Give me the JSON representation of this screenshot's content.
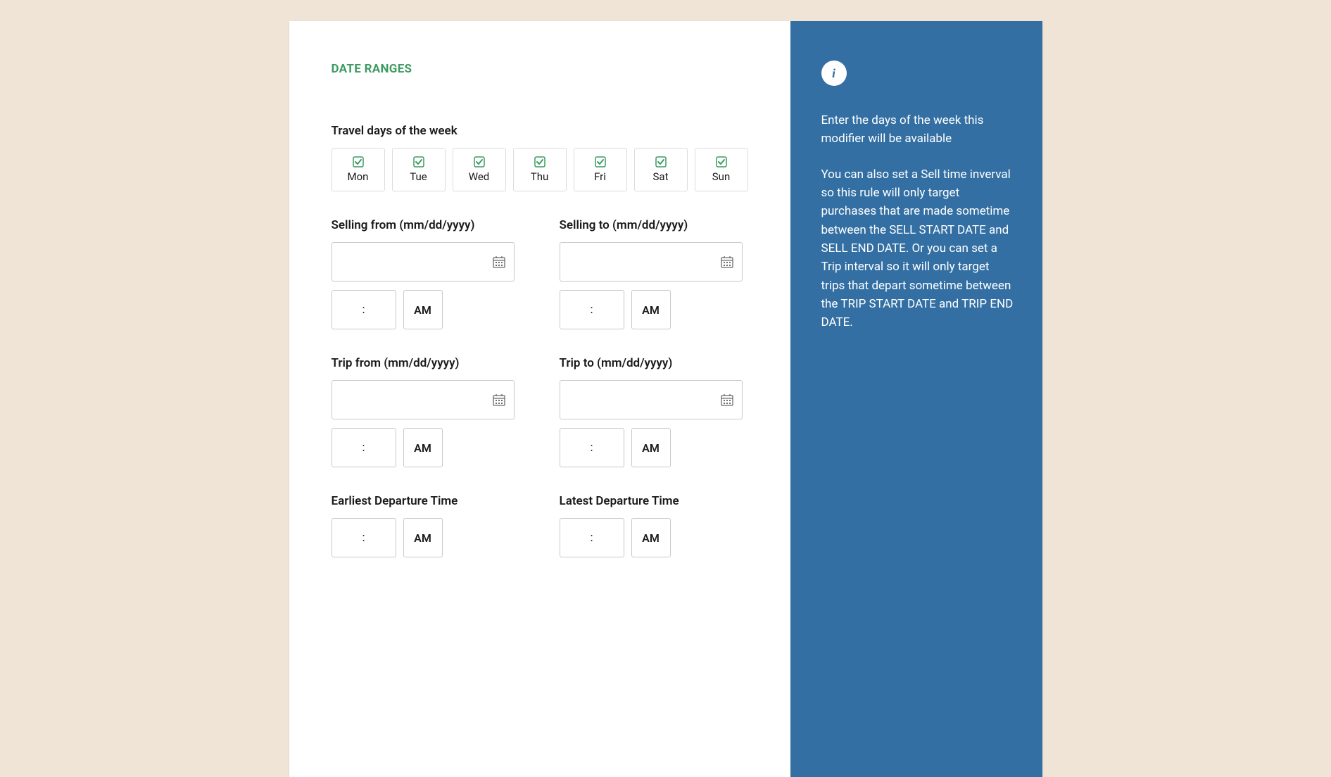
{
  "section_title": "DATE RANGES",
  "travel_days_heading": "Travel days of the week",
  "days": [
    {
      "label": "Mon",
      "checked": true
    },
    {
      "label": "Tue",
      "checked": true
    },
    {
      "label": "Wed",
      "checked": true
    },
    {
      "label": "Thu",
      "checked": true
    },
    {
      "label": "Fri",
      "checked": true
    },
    {
      "label": "Sat",
      "checked": true
    },
    {
      "label": "Sun",
      "checked": true
    }
  ],
  "selling_from": {
    "label": "Selling from (mm/dd/yyyy)",
    "date_value": "",
    "time_value": ":",
    "ampm": "AM"
  },
  "selling_to": {
    "label": "Selling to (mm/dd/yyyy)",
    "date_value": "",
    "time_value": ":",
    "ampm": "AM"
  },
  "trip_from": {
    "label": "Trip from (mm/dd/yyyy)",
    "date_value": "",
    "time_value": ":",
    "ampm": "AM"
  },
  "trip_to": {
    "label": "Trip to (mm/dd/yyyy)",
    "date_value": "",
    "time_value": ":",
    "ampm": "AM"
  },
  "earliest_departure": {
    "label": "Earliest Departure Time",
    "time_value": ":",
    "ampm": "AM"
  },
  "latest_departure": {
    "label": "Latest Departure Time",
    "time_value": ":",
    "ampm": "AM"
  },
  "info_panel": {
    "para1": "Enter the days of the week this modifier will be available",
    "para2": "You can also set a Sell time inverval so this rule will only target purchases that are made sometime between the SELL START DATE and SELL END DATE. Or you can set a Trip interval so it will only target trips that depart sometime between the TRIP START DATE and TRIP END DATE."
  },
  "colors": {
    "accent_green": "#3d9a61",
    "panel_blue": "#336fa3",
    "page_bg": "#f0e4d7"
  }
}
